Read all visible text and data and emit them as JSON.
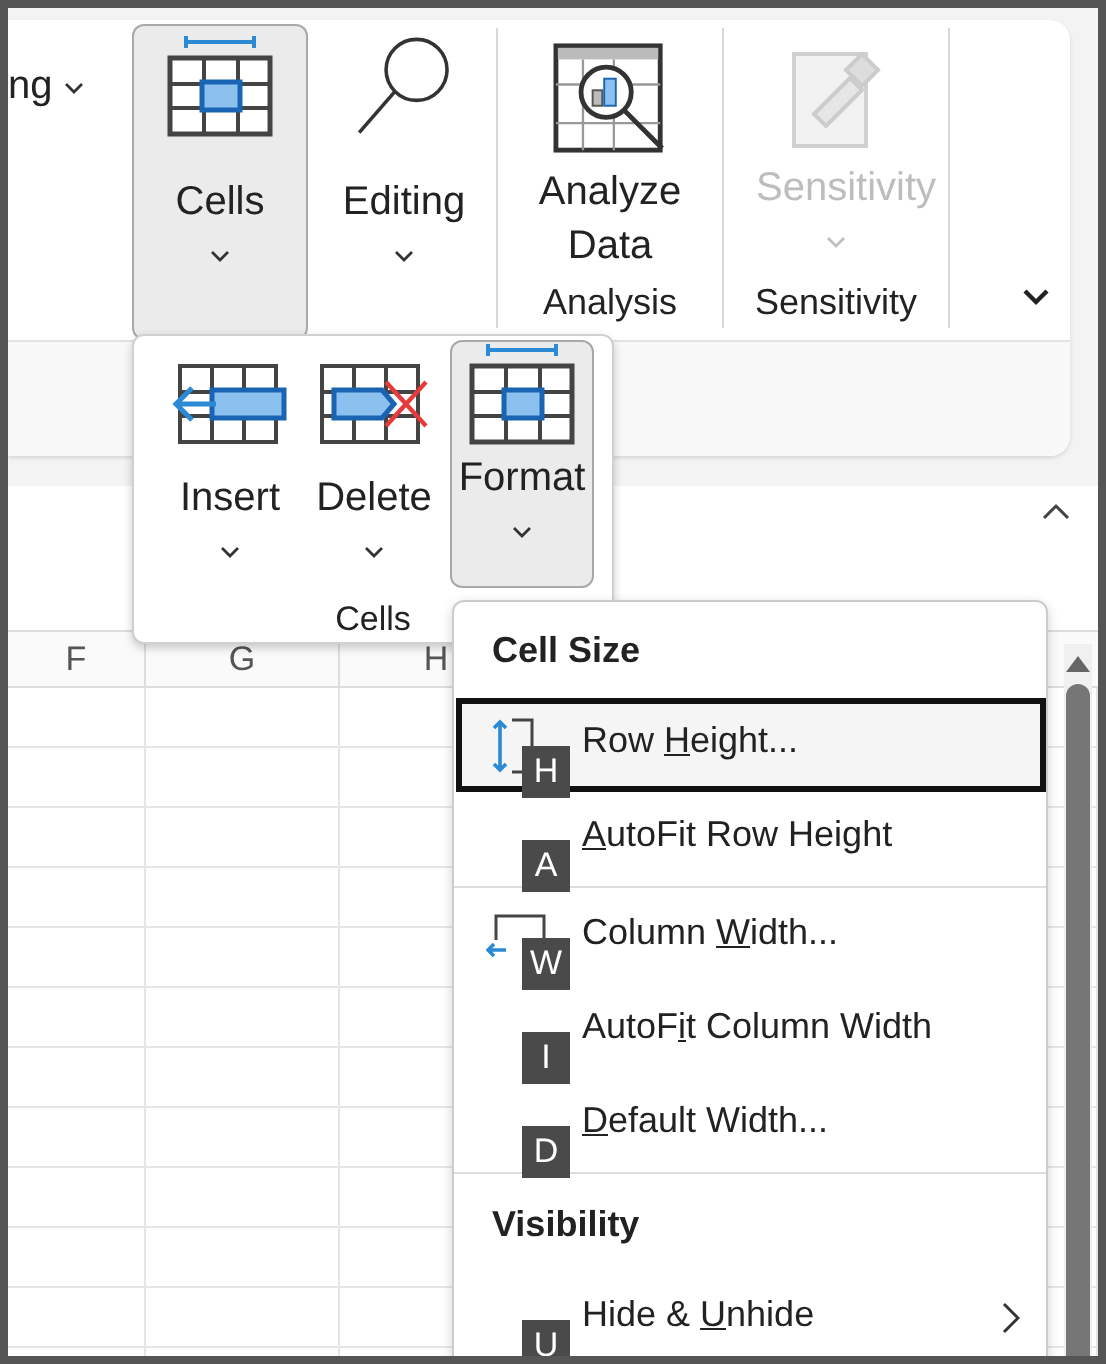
{
  "ribbon": {
    "cut_label": "ng",
    "groups": [
      {
        "kind": "collapsed",
        "label": "Cells",
        "selected": true
      },
      {
        "kind": "collapsed",
        "label": "Editing",
        "selected": false
      },
      {
        "kind": "group",
        "name": "Analysis",
        "button": {
          "label": "Analyze Data",
          "disabled": false
        }
      },
      {
        "kind": "group",
        "name": "Sensitivity",
        "button": {
          "label": "Sensitivity",
          "disabled": true
        }
      }
    ]
  },
  "cells_popup": {
    "buttons": [
      {
        "label": "Insert",
        "selected": false
      },
      {
        "label": "Delete",
        "selected": false
      },
      {
        "label": "Format",
        "selected": true
      }
    ],
    "group_label": "Cells"
  },
  "sheet": {
    "columns": [
      "F",
      "G",
      "H"
    ]
  },
  "format_menu": [
    {
      "kind": "header",
      "label": "Cell Size"
    },
    {
      "kind": "height-command",
      "before": "Row ",
      "key": "H",
      "after": "eight...",
      "key_tip": "H",
      "selected": true
    },
    {
      "kind": "command",
      "key": "A",
      "after": "utoFit Row Height",
      "key_tip": "A",
      "selected": false
    },
    {
      "kind": "separator"
    },
    {
      "kind": "width-command",
      "before": "Column ",
      "key": "W",
      "after": "idth...",
      "key_tip": "W",
      "selected": false
    },
    {
      "kind": "command",
      "before": "AutoF",
      "key": "i",
      "after": "t Column Width",
      "key_tip": "I",
      "selected": false
    },
    {
      "kind": "command",
      "key": "D",
      "after": "efault Width...",
      "key_tip": "D",
      "selected": false
    },
    {
      "kind": "separator"
    },
    {
      "kind": "header",
      "label": "Visibility"
    },
    {
      "kind": "submenu",
      "before": "Hide & ",
      "key": "U",
      "after": "nhide",
      "key_tip": "U",
      "selected": false
    }
  ]
}
